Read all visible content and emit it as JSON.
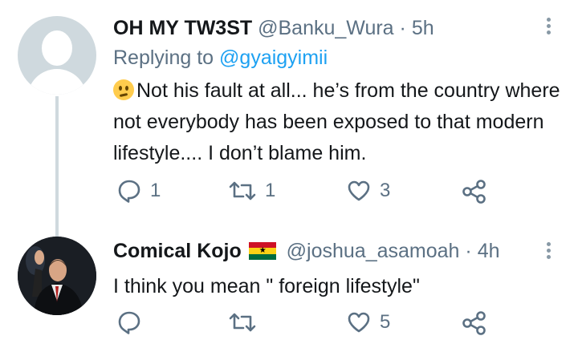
{
  "tweets": [
    {
      "name": "OH MY TW3ST",
      "handle": "@Banku_Wura",
      "separator": "·",
      "time": "5h",
      "replying_label": "Replying to",
      "replying_to": "@gyaigyimii",
      "text": "Not his fault at all... he’s from the country where not everybody has been exposed to that modern lifestyle.... I don’t blame him.",
      "text_prefix_icon": "slightly-frowning-face-emoji",
      "replies": "1",
      "retweets": "1",
      "likes": "3"
    },
    {
      "name": "Comical Kojo",
      "name_icon": "ghana-flag-emoji",
      "handle": "@joshua_asamoah",
      "separator": "·",
      "time": "4h",
      "text": "I think you mean \" foreign lifestyle\"",
      "replies": "",
      "retweets": "",
      "likes": "5"
    }
  ],
  "colors": {
    "text": "#14171a",
    "secondary": "#5b7083",
    "link": "#1da1f2",
    "thread_line": "#cfd9de"
  },
  "icons": [
    "reply-icon",
    "retweet-icon",
    "like-icon",
    "share-icon",
    "more-icon"
  ]
}
